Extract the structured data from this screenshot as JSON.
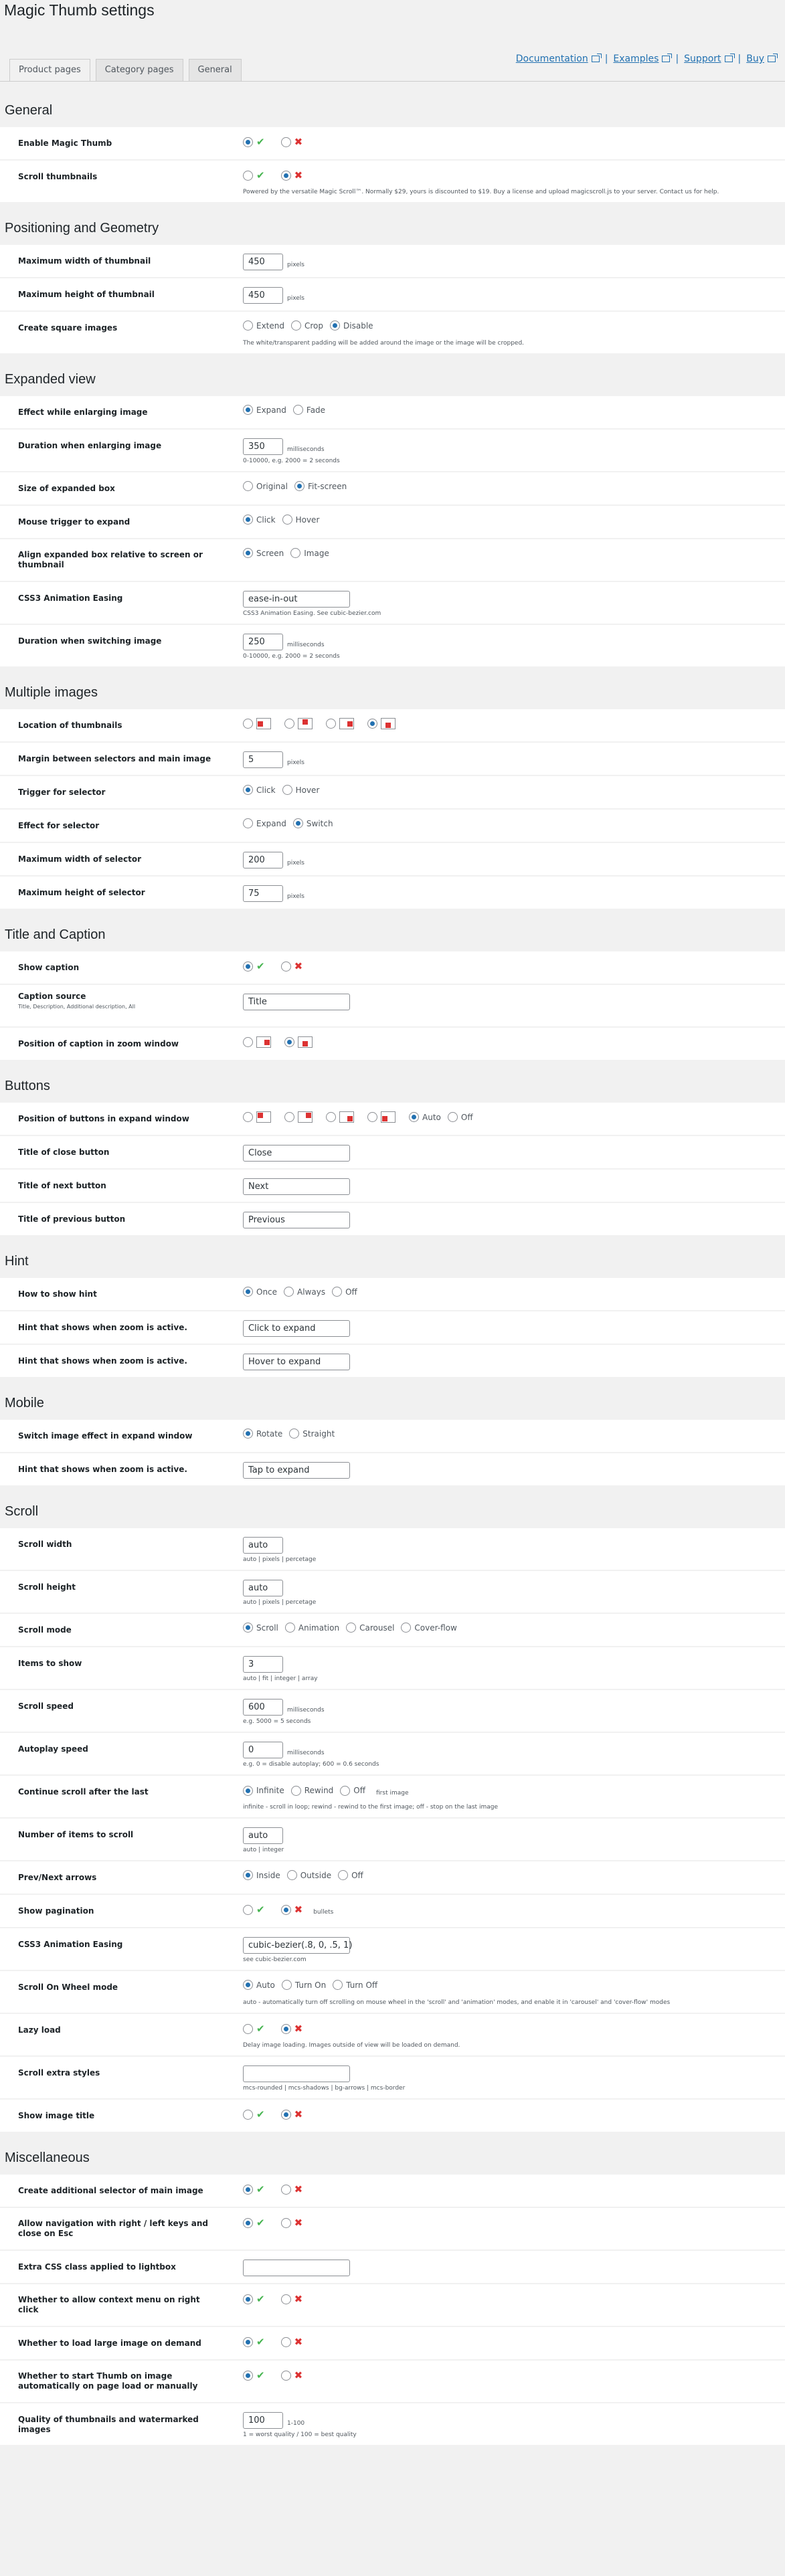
{
  "page_title": "Magic Thumb settings",
  "tabs": [
    "Product pages",
    "Category pages",
    "General"
  ],
  "links": [
    "Documentation",
    "Examples",
    "Support",
    "Buy"
  ],
  "rows": [
    {
      "t": "section",
      "label": "General"
    },
    {
      "t": "yn",
      "label": "Enable Magic Thumb",
      "sel": 0
    },
    {
      "t": "yn",
      "label": "Scroll thumbnails",
      "sel": 1,
      "hint": "Powered by the versatile Magic Scroll™. Normally $29, yours is discounted to $19. Buy a license and upload magicscroll.js to your server. Contact us for help."
    },
    {
      "t": "section",
      "label": "Positioning and Geometry"
    },
    {
      "t": "text",
      "label": "Maximum width of thumbnail",
      "value": "450",
      "unit": "pixels"
    },
    {
      "t": "text",
      "label": "Maximum height of thumbnail",
      "value": "450",
      "unit": "pixels"
    },
    {
      "t": "radio",
      "label": "Create square images",
      "options": [
        "Extend",
        "Crop",
        "Disable"
      ],
      "sel": 2,
      "hint": "The white/transparent padding will be added around the image or the image will be cropped."
    },
    {
      "t": "section",
      "label": "Expanded view"
    },
    {
      "t": "radio",
      "label": "Effect while enlarging image",
      "options": [
        "Expand",
        "Fade"
      ],
      "sel": 0
    },
    {
      "t": "text",
      "label": "Duration when enlarging image",
      "value": "350",
      "unit": "milliseconds",
      "hint": "0-10000, e.g. 2000 = 2 seconds"
    },
    {
      "t": "radio",
      "label": "Size of expanded box",
      "options": [
        "Original",
        "Fit-screen"
      ],
      "sel": 1
    },
    {
      "t": "radio",
      "label": "Mouse trigger to expand",
      "options": [
        "Click",
        "Hover"
      ],
      "sel": 0
    },
    {
      "t": "radio",
      "label": "Align expanded box relative to screen or thumbnail",
      "options": [
        "Screen",
        "Image"
      ],
      "sel": 0
    },
    {
      "t": "textw",
      "label": "CSS3 Animation Easing",
      "value": "ease-in-out",
      "hint": "CSS3 Animation Easing. See cubic-bezier.com"
    },
    {
      "t": "text",
      "label": "Duration when switching image",
      "value": "250",
      "unit": "milliseconds",
      "hint": "0-10000, e.g. 2000 = 2 seconds"
    },
    {
      "t": "section",
      "label": "Multiple images"
    },
    {
      "t": "icons",
      "label": "Location of thumbnails",
      "icons": [
        "left",
        "top",
        "right",
        "bottom"
      ],
      "sel": 3
    },
    {
      "t": "text",
      "label": "Margin between selectors and main image",
      "value": "5",
      "unit": "pixels"
    },
    {
      "t": "radio",
      "label": "Trigger for selector",
      "options": [
        "Click",
        "Hover"
      ],
      "sel": 0
    },
    {
      "t": "radio",
      "label": "Effect for selector",
      "options": [
        "Expand",
        "Switch"
      ],
      "sel": 1
    },
    {
      "t": "text",
      "label": "Maximum width of selector",
      "value": "200",
      "unit": "pixels"
    },
    {
      "t": "text",
      "label": "Maximum height of selector",
      "value": "75",
      "unit": "pixels"
    },
    {
      "t": "section",
      "label": "Title and Caption"
    },
    {
      "t": "yn",
      "label": "Show caption",
      "sel": 0
    },
    {
      "t": "textw",
      "label": "Caption source",
      "value": "Title",
      "sub": "Title, Description, Additional description, All"
    },
    {
      "t": "icons",
      "label": "Position of caption in zoom window",
      "icons": [
        "right",
        "bottom"
      ],
      "sel": 1
    },
    {
      "t": "section",
      "label": "Buttons"
    },
    {
      "t": "icons",
      "label": "Position of buttons in expand window",
      "icons": [
        "top-left",
        "top-right",
        "bottom-right",
        "bottom-left"
      ],
      "sel": -1,
      "extra": [
        "Auto",
        "Off"
      ],
      "extra_sel": 0
    },
    {
      "t": "textw",
      "label": "Title of close button",
      "value": "Close"
    },
    {
      "t": "textw",
      "label": "Title of next button",
      "value": "Next"
    },
    {
      "t": "textw",
      "label": "Title of previous button",
      "value": "Previous"
    },
    {
      "t": "section",
      "label": "Hint"
    },
    {
      "t": "radio",
      "label": "How to show hint",
      "options": [
        "Once",
        "Always",
        "Off"
      ],
      "sel": 0
    },
    {
      "t": "textw",
      "label": "Hint that shows when zoom is active.",
      "value": "Click to expand"
    },
    {
      "t": "textw",
      "label": "Hint that shows when zoom is active.",
      "value": "Hover to expand"
    },
    {
      "t": "section",
      "label": "Mobile"
    },
    {
      "t": "radio",
      "label": "Switch image effect in expand window",
      "options": [
        "Rotate",
        "Straight"
      ],
      "sel": 0
    },
    {
      "t": "textw",
      "label": "Hint that shows when zoom is active.",
      "value": "Tap to expand"
    },
    {
      "t": "section",
      "label": "Scroll"
    },
    {
      "t": "text",
      "label": "Scroll width",
      "value": "auto",
      "hint": "auto | pixels | percetage"
    },
    {
      "t": "text",
      "label": "Scroll height",
      "value": "auto",
      "hint": "auto | pixels | percetage"
    },
    {
      "t": "radio",
      "label": "Scroll mode",
      "options": [
        "Scroll",
        "Animation",
        "Carousel",
        "Cover-flow"
      ],
      "sel": 0
    },
    {
      "t": "text",
      "label": "Items to show",
      "value": "3",
      "hint": "auto | fit | integer | array"
    },
    {
      "t": "text",
      "label": "Scroll speed",
      "value": "600",
      "unit": "milliseconds",
      "hint": "e.g. 5000 = 5 seconds"
    },
    {
      "t": "text",
      "label": "Autoplay speed",
      "value": "0",
      "unit": "milliseconds",
      "hint": "e.g. 0 = disable autoplay; 600 = 0.6 seconds"
    },
    {
      "t": "radio",
      "label": "Continue scroll after the last",
      "options": [
        "Infinite",
        "Rewind",
        "Off"
      ],
      "sel": 0,
      "unit": "first image",
      "hint": "infinite - scroll in loop; rewind - rewind to the first image; off - stop on the last image"
    },
    {
      "t": "text",
      "label": "Number of items to scroll",
      "value": "auto",
      "hint": "auto | integer"
    },
    {
      "t": "radio",
      "label": "Prev/Next arrows",
      "options": [
        "Inside",
        "Outside",
        "Off"
      ],
      "sel": 0
    },
    {
      "t": "yn",
      "label": "Show pagination",
      "sel": 1,
      "unit": "bullets"
    },
    {
      "t": "textw",
      "label": "CSS3 Animation Easing",
      "value": "cubic-bezier(.8, 0, .5, 1)",
      "hint": "see cubic-bezier.com"
    },
    {
      "t": "radio",
      "label": "Scroll On Wheel mode",
      "options": [
        "Auto",
        "Turn On",
        "Turn Off"
      ],
      "sel": 0,
      "hint": "auto - automatically turn off scrolling on mouse wheel in the 'scroll' and 'animation' modes, and enable it in 'carousel' and 'cover-flow' modes"
    },
    {
      "t": "yn",
      "label": "Lazy load",
      "sel": 1,
      "hint": "Delay image loading. Images outside of view will be loaded on demand."
    },
    {
      "t": "textw",
      "label": "Scroll extra styles",
      "value": "",
      "hint": "mcs-rounded | mcs-shadows | bg-arrows | mcs-border"
    },
    {
      "t": "yn",
      "label": "Show image title",
      "sel": 1
    },
    {
      "t": "section",
      "label": "Miscellaneous"
    },
    {
      "t": "yn",
      "label": "Create additional selector of main image",
      "sel": 0
    },
    {
      "t": "yn",
      "label": "Allow navigation with right / left keys and close on Esc",
      "sel": 0
    },
    {
      "t": "textw",
      "label": "Extra CSS class applied to lightbox",
      "value": ""
    },
    {
      "t": "yn",
      "label": "Whether to allow context menu on right click",
      "sel": 0
    },
    {
      "t": "yn",
      "label": "Whether to load large image on demand",
      "sel": 0
    },
    {
      "t": "yn",
      "label": "Whether to start Thumb on image automatically on page load or manually",
      "sel": 0
    },
    {
      "t": "text",
      "label": "Quality of thumbnails and watermarked images",
      "value": "100",
      "unit": "1-100",
      "hint": "1 = worst quality / 100 = best quality"
    }
  ]
}
